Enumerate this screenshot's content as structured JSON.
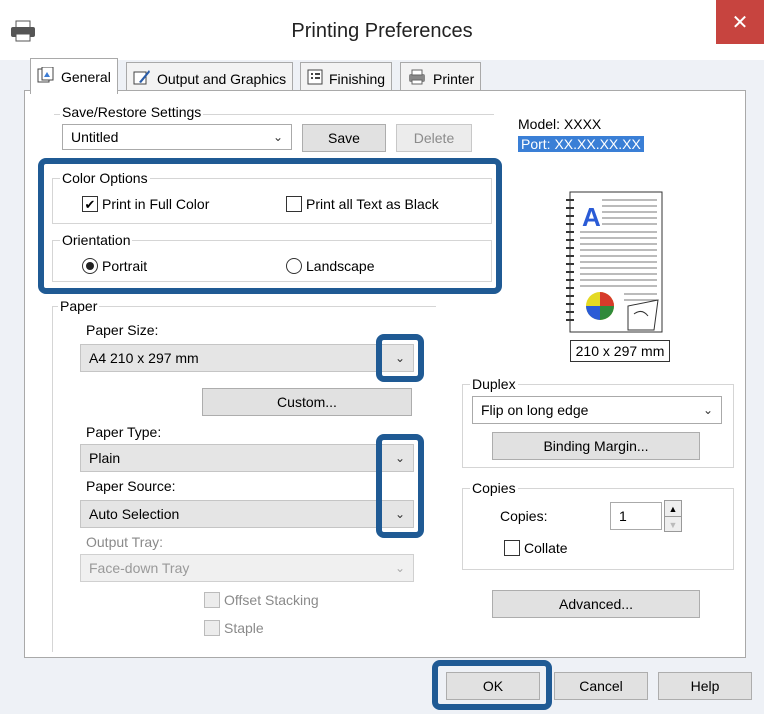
{
  "window": {
    "title": "Printing Preferences",
    "close_label": "✕"
  },
  "tabs": [
    {
      "label": "General"
    },
    {
      "label": "Output and Graphics"
    },
    {
      "label": "Finishing"
    },
    {
      "label": "Printer"
    }
  ],
  "save_restore": {
    "legend": "Save/Restore Settings",
    "selected": "Untitled",
    "save_label": "Save",
    "delete_label": "Delete"
  },
  "printer_info": {
    "model": "Model: XXXX",
    "port": "Port: XX.XX.XX.XX"
  },
  "color_options": {
    "legend": "Color Options",
    "full_color_label": "Print in Full Color",
    "full_color_checked": true,
    "text_black_label": "Print all Text as Black",
    "text_black_checked": false
  },
  "orientation": {
    "legend": "Orientation",
    "portrait_label": "Portrait",
    "landscape_label": "Landscape",
    "selected": "Portrait"
  },
  "preview": {
    "size_caption": "210 x 297 mm"
  },
  "paper": {
    "legend": "Paper",
    "size_label": "Paper Size:",
    "size_value": "A4 210 x 297 mm",
    "custom_label": "Custom...",
    "type_label": "Paper Type:",
    "type_value": "Plain",
    "source_label": "Paper Source:",
    "source_value": "Auto Selection",
    "output_tray_label": "Output Tray:",
    "output_tray_value": "Face-down Tray",
    "offset_label": "Offset Stacking",
    "staple_label": "Staple"
  },
  "duplex": {
    "legend": "Duplex",
    "value": "Flip on long edge",
    "binding_label": "Binding Margin..."
  },
  "copies": {
    "legend": "Copies",
    "label": "Copies:",
    "value": "1",
    "collate_label": "Collate"
  },
  "advanced_label": "Advanced...",
  "footer": {
    "ok_label": "OK",
    "cancel_label": "Cancel",
    "help_label": "Help"
  }
}
